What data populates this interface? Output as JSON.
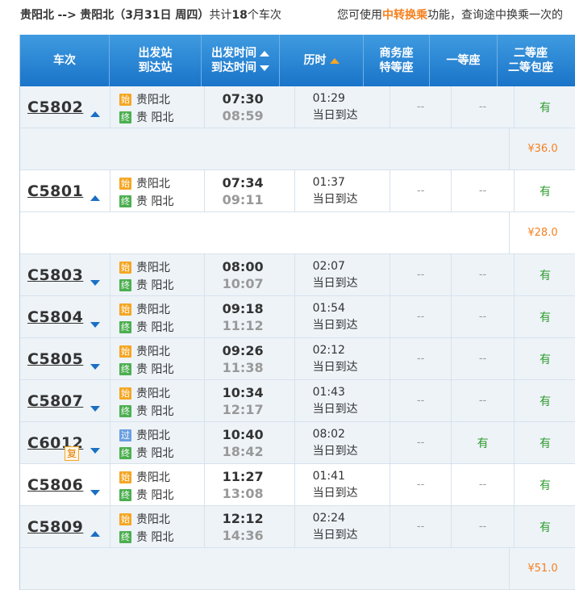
{
  "summary": {
    "from": "贵阳北",
    "arrow": "-->",
    "to": "贵阳北",
    "date": "（3月31日  周四）",
    "count_prefix": "共计",
    "count": "18",
    "count_suffix": "个车次"
  },
  "notice": {
    "prefix": "您可使用",
    "highlight": "中转换乘",
    "suffix": "功能，查询途中换乘一次的"
  },
  "headers": {
    "train": "车次",
    "station_top": "出发站",
    "station_bottom": "到达站",
    "time_top": "出发时间",
    "time_bottom": "到达时间",
    "duration": "历时",
    "business_top": "商务座",
    "business_bottom": "特等座",
    "first": "一等座",
    "second_top": "二等座",
    "second_bottom": "二等包座"
  },
  "colors": {
    "header": "#1a74c9",
    "price": "#f5801f",
    "available": "#2e9b2e",
    "start_tag": "#f5a623",
    "end_tag": "#4caf50"
  },
  "trains": [
    {
      "no": "C5802",
      "arrow": "up",
      "tag1": "始",
      "tag1_type": "start",
      "from": "贵阳北",
      "tag2": "终",
      "to": "贵 阳北",
      "dep": "07:30",
      "arr": "08:59",
      "dur": "01:29",
      "arrive_day": "当日到达",
      "business": "--",
      "first": "--",
      "second": "有",
      "price": "¥36.0",
      "price_bg": "alt"
    },
    {
      "no": "C5801",
      "arrow": "up",
      "tag1": "始",
      "tag1_type": "start",
      "from": "贵阳北",
      "tag2": "终",
      "to": "贵 阳北",
      "dep": "07:34",
      "arr": "09:11",
      "dur": "01:37",
      "arrive_day": "当日到达",
      "business": "--",
      "first": "--",
      "second": "有",
      "price": "¥28.0",
      "price_bg": "white"
    },
    {
      "no": "C5803",
      "arrow": "down",
      "tag1": "始",
      "tag1_type": "start",
      "from": "贵阳北",
      "tag2": "终",
      "to": "贵 阳北",
      "dep": "08:00",
      "arr": "10:07",
      "dur": "02:07",
      "arrive_day": "当日到达",
      "business": "--",
      "first": "--",
      "second": "有"
    },
    {
      "no": "C5804",
      "arrow": "down",
      "tag1": "始",
      "tag1_type": "start",
      "from": "贵阳北",
      "tag2": "终",
      "to": "贵 阳北",
      "dep": "09:18",
      "arr": "11:12",
      "dur": "01:54",
      "arrive_day": "当日到达",
      "business": "--",
      "first": "--",
      "second": "有"
    },
    {
      "no": "C5805",
      "arrow": "down",
      "tag1": "始",
      "tag1_type": "start",
      "from": "贵阳北",
      "tag2": "终",
      "to": "贵 阳北",
      "dep": "09:26",
      "arr": "11:38",
      "dur": "02:12",
      "arrive_day": "当日到达",
      "business": "--",
      "first": "--",
      "second": "有"
    },
    {
      "no": "C5807",
      "arrow": "down",
      "tag1": "始",
      "tag1_type": "start",
      "from": "贵阳北",
      "tag2": "终",
      "to": "贵 阳北",
      "dep": "10:34",
      "arr": "12:17",
      "dur": "01:43",
      "arrive_day": "当日到达",
      "business": "--",
      "first": "--",
      "second": "有"
    },
    {
      "no": "C6012",
      "arrow": "down",
      "fu": "复",
      "tag1": "过",
      "tag1_type": "pass",
      "from": "贵阳北",
      "tag2": "终",
      "to": "贵 阳北",
      "dep": "10:40",
      "arr": "18:42",
      "dur": "08:02",
      "arrive_day": "当日到达",
      "business": "--",
      "first": "有",
      "second": "有"
    },
    {
      "no": "C5806",
      "arrow": "down",
      "tag1": "始",
      "tag1_type": "start",
      "from": "贵阳北",
      "tag2": "终",
      "to": "贵 阳北",
      "dep": "11:27",
      "arr": "13:08",
      "dur": "01:41",
      "arrive_day": "当日到达",
      "business": "--",
      "first": "--",
      "second": "有"
    },
    {
      "no": "C5809",
      "arrow": "up",
      "tag1": "始",
      "tag1_type": "start",
      "from": "贵阳北",
      "tag2": "终",
      "to": "贵 阳北",
      "dep": "12:12",
      "arr": "14:36",
      "dur": "02:24",
      "arrive_day": "当日到达",
      "business": "--",
      "first": "--",
      "second": "有",
      "price": "¥51.0",
      "price_bg": "alt"
    }
  ]
}
